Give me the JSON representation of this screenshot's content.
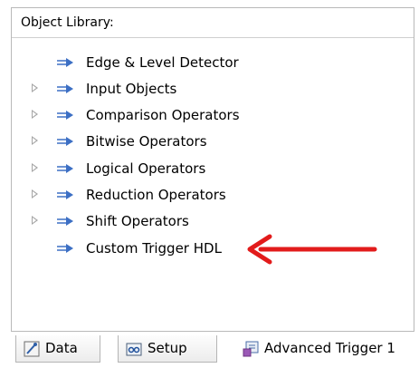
{
  "library": {
    "header": "Object Library:",
    "items": [
      {
        "label": "Edge & Level Detector",
        "expandable": false
      },
      {
        "label": "Input Objects",
        "expandable": true
      },
      {
        "label": "Comparison Operators",
        "expandable": true
      },
      {
        "label": "Bitwise Operators",
        "expandable": true
      },
      {
        "label": "Logical Operators",
        "expandable": true
      },
      {
        "label": "Reduction Operators",
        "expandable": true
      },
      {
        "label": "Shift Operators",
        "expandable": true
      },
      {
        "label": "Custom Trigger HDL",
        "expandable": false
      }
    ]
  },
  "tabs": [
    {
      "label": "Data",
      "icon": "data-probe-icon",
      "active": false
    },
    {
      "label": "Setup",
      "icon": "setup-icon",
      "active": false
    },
    {
      "label": "Advanced Trigger 1",
      "icon": "advanced-trigger-icon",
      "active": true
    }
  ],
  "colors": {
    "object_icon": "#3c6fc4",
    "annotation_arrow": "#e21b1b",
    "expander": "#a6a6a6"
  }
}
